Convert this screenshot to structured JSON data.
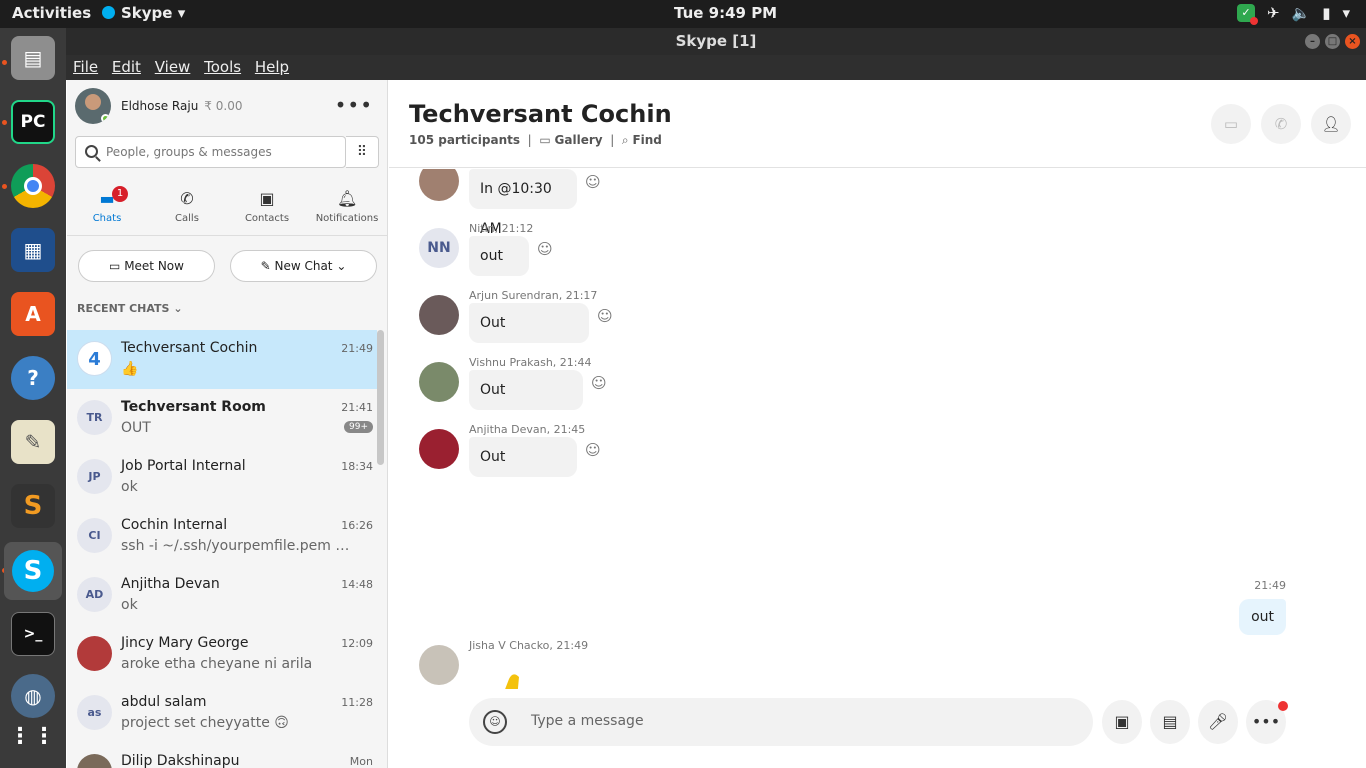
{
  "system": {
    "activities": "Activities",
    "app_menu": "Skype",
    "clock": "Tue  9:49 PM"
  },
  "window": {
    "title": "Skype [1]",
    "menu": [
      "File",
      "Edit",
      "View",
      "Tools",
      "Help"
    ]
  },
  "profile": {
    "name": "Eldhose Raju",
    "credit": "₹ 0.00"
  },
  "search": {
    "placeholder": "People, groups & messages"
  },
  "nav": {
    "tabs": [
      {
        "label": "Chats",
        "badge": "1"
      },
      {
        "label": "Calls"
      },
      {
        "label": "Contacts"
      },
      {
        "label": "Notifications"
      }
    ]
  },
  "actions": {
    "meet_now": "Meet Now",
    "new_chat": "New Chat"
  },
  "recent_label": "RECENT CHATS",
  "chats": [
    {
      "initials": "",
      "name": "Techversant Cochin",
      "preview": "👍",
      "time": "21:49",
      "selected": true
    },
    {
      "initials": "TR",
      "name": "Techversant Room",
      "preview": "OUT",
      "time": "21:41",
      "unread": "99+"
    },
    {
      "initials": "JP",
      "name": "Job Portal Internal",
      "preview": "ok",
      "time": "18:34"
    },
    {
      "initials": "CI",
      "name": "Cochin Internal",
      "preview": "ssh -i ~/.ssh/yourpemfile.pem s...",
      "time": "16:26"
    },
    {
      "initials": "AD",
      "name": "Anjitha Devan",
      "preview": "ok",
      "time": "14:48"
    },
    {
      "initials": "",
      "name": "Jincy Mary George",
      "preview": "aroke etha cheyane ni arila",
      "time": "12:09"
    },
    {
      "initials": "as",
      "name": "abdul salam",
      "preview": "project set cheyyatte 🙃",
      "time": "11:28"
    },
    {
      "initials": "",
      "name": "Dilip Dakshinapu",
      "preview": "",
      "time": "Mon"
    }
  ],
  "conversation": {
    "title": "Techversant Cochin",
    "participants": "105 participants",
    "gallery": "Gallery",
    "find": "Find",
    "messages": [
      {
        "initials": "",
        "sender": "",
        "text": "In @10:30 AM"
      },
      {
        "initials": "NN",
        "sender": "Nitin, 21:12",
        "text": "out"
      },
      {
        "initials": "",
        "sender": "Arjun Surendran, 21:17",
        "text": "Out"
      },
      {
        "initials": "",
        "sender": "Vishnu Prakash, 21:44",
        "text": "Out"
      },
      {
        "initials": "",
        "sender": "Anjitha Devan, 21:45",
        "text": "Out"
      }
    ],
    "mine_time": "21:49",
    "mine_text": "out",
    "last_sender": "Jisha V Chacko, 21:49"
  },
  "composer": {
    "placeholder": "Type a message"
  }
}
